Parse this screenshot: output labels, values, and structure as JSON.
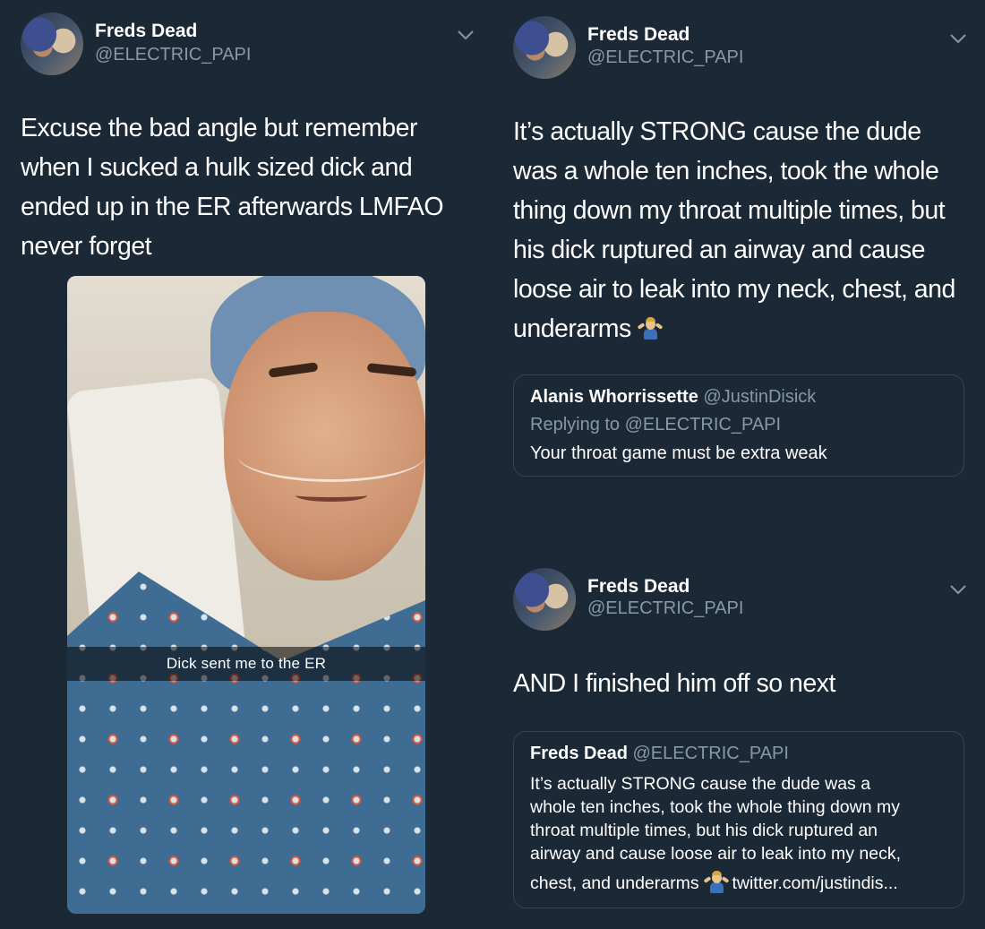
{
  "tweet1": {
    "name": "Freds Dead",
    "handle": "@ELECTRIC_PAPI",
    "text": "Excuse the bad angle but remember when I sucked a hulk sized dick and ended up in the ER afterwards LMFAO never forget",
    "photo_caption": "Dick sent me to the ER"
  },
  "tweet2": {
    "name": "Freds Dead",
    "handle": "@ELECTRIC_PAPI",
    "text": "It’s actually STRONG cause the dude was a whole ten inches, took the whole thing down my throat multiple times, but his dick ruptured an airway and cause loose air to leak into my neck, chest, and underarms",
    "emoji": "person-shrugging-emoji",
    "quote": {
      "name": "Alanis Whorrissette",
      "handle": "@JustinDisick",
      "replying_prefix": "Replying to ",
      "replying_to": "@ELECTRIC_PAPI",
      "text": "Your throat game must be extra weak"
    }
  },
  "tweet3": {
    "name": "Freds Dead",
    "handle": "@ELECTRIC_PAPI",
    "text": "AND I finished him off so next",
    "quote": {
      "name": "Freds Dead",
      "handle": "@ELECTRIC_PAPI",
      "lines": [
        "It’s actually STRONG cause the dude was a",
        "whole ten inches, took the whole thing down my",
        "throat multiple times, but his dick ruptured an",
        "airway and cause loose air to leak into my neck,"
      ],
      "last_line_start": "chest, and underarms",
      "last_line_end": "twitter.com/justindis..."
    }
  },
  "colors": {
    "background": "#1b2836",
    "secondary_text": "#8899a6",
    "border": "#38444d"
  }
}
